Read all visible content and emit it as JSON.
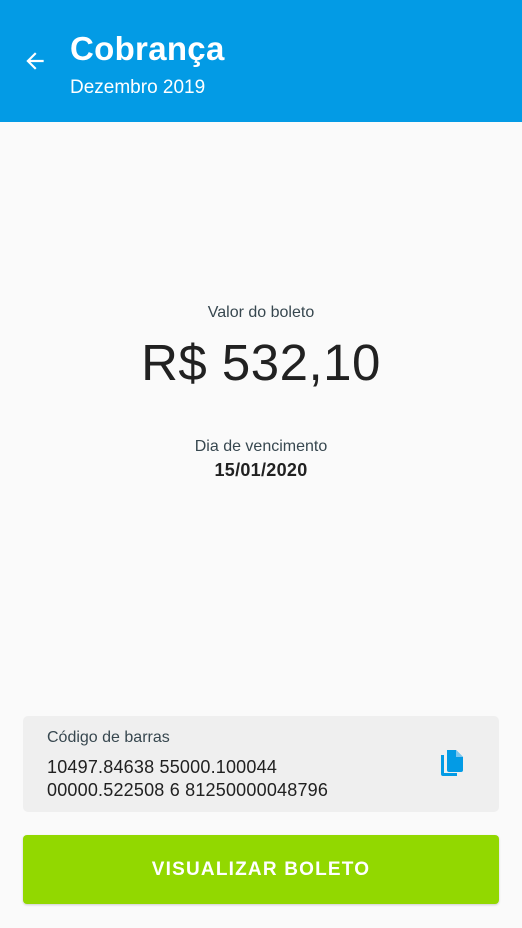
{
  "header": {
    "title": "Cobrança",
    "subtitle": "Dezembro 2019",
    "back_icon": "arrow-left-icon"
  },
  "amount": {
    "label": "Valor do boleto",
    "value": "R$ 532,10"
  },
  "due": {
    "label": "Dia de vencimento",
    "value": "15/01/2020"
  },
  "barcode": {
    "label": "Código de barras",
    "lines": [
      "10497.84638 55000.100044",
      "00000.522508 6 81250000048796"
    ],
    "copy_icon": "copy-icon"
  },
  "actions": {
    "view_boleto_label": "VISUALIZAR BOLETO"
  },
  "colors": {
    "header_bg": "#039be5",
    "primary_button": "#92d800",
    "copy_icon": "#039be5",
    "background": "#fafafa",
    "card_bg": "#efefef"
  }
}
